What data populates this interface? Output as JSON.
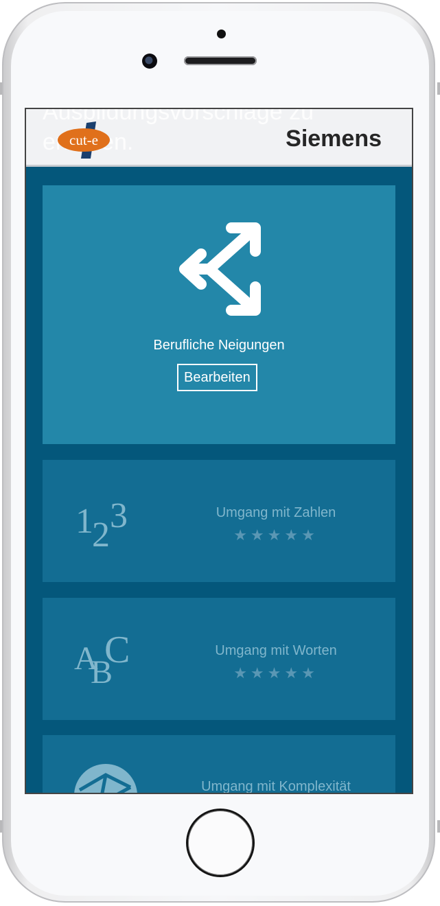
{
  "header": {
    "background_text": "Ausbildungsvorschläge zu\nerhalten.",
    "logo_text": "cut-e",
    "brand": "Siemens"
  },
  "main_card": {
    "icon": "split-arrows-icon",
    "title": "Berufliche Neigungen",
    "button_label": "Bearbeiten"
  },
  "cards": [
    {
      "icon": "numbers-123-icon",
      "label": "Umgang mit Zahlen",
      "stars": "★★★★★",
      "rating": 0
    },
    {
      "icon": "letters-abc-icon",
      "label": "Umgang mit Worten",
      "stars": "★★★★★",
      "rating": 0
    },
    {
      "icon": "globe-network-icon",
      "label": "Umgang mit Komplexität",
      "stars": "★★★★★",
      "rating": 0
    }
  ],
  "colors": {
    "screen_bg": "#04577b",
    "main_card": "#2387a9",
    "sub_card": "#136d93",
    "header_bg": "#f1f2f4",
    "logo_orange": "#e0701b",
    "logo_navy": "#1a3f6e"
  }
}
